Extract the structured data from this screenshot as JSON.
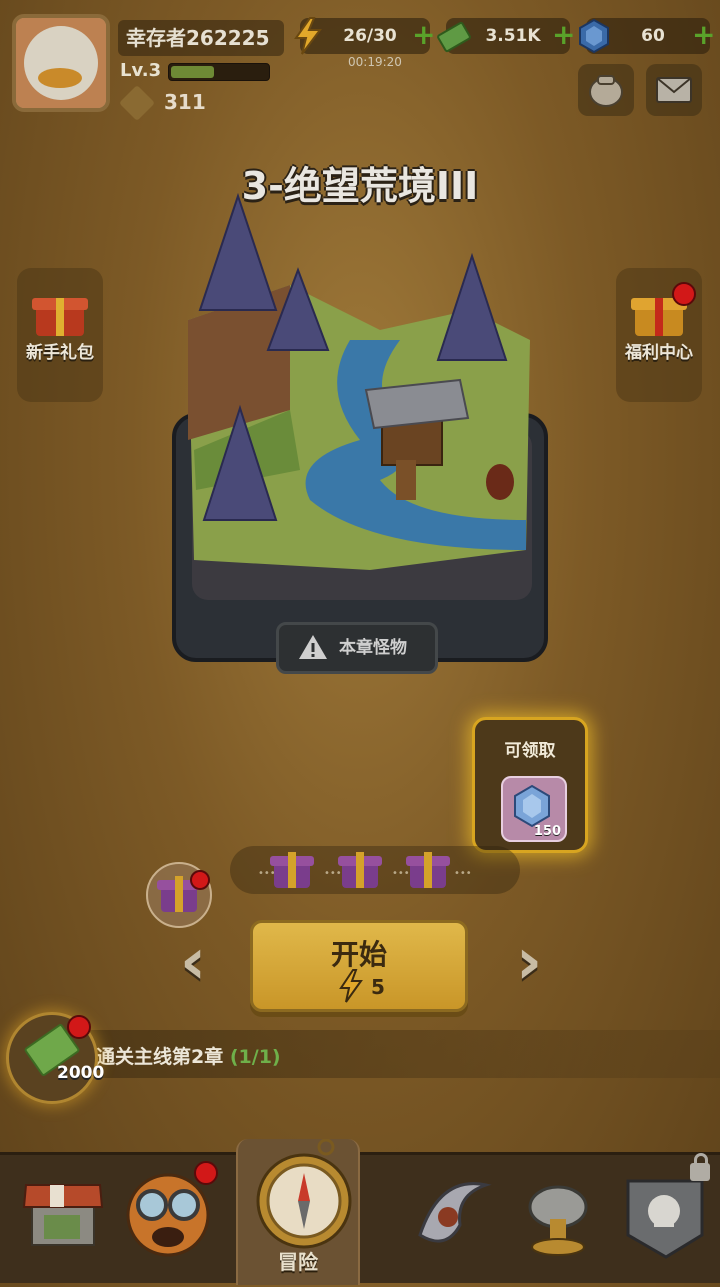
{
  "player": {
    "name": "幸存者262225",
    "level": "Lv.3",
    "xp_fraction": 0.45,
    "trophies": "311"
  },
  "resources": {
    "energy": "26/30",
    "energy_timer": "00:19:20",
    "cash": "3.51K",
    "gems": "60"
  },
  "stage": {
    "title": "3-绝望荒境III",
    "monsters_button": "本章怪物"
  },
  "side_left": {
    "label": "新手礼包"
  },
  "side_right": {
    "label": "福利中心"
  },
  "claim_card": {
    "title": "可领取",
    "amount": "150"
  },
  "start_button": {
    "label": "开始",
    "cost": "5"
  },
  "quest": {
    "text": "通关主线第2章",
    "progress": "(1/1)",
    "reward": "2000"
  },
  "nav": {
    "adventure_label": "冒险"
  },
  "colors": {
    "accent_gold": "#d8a520",
    "notification_red": "#d21818",
    "progress_green": "#6fb04a"
  }
}
